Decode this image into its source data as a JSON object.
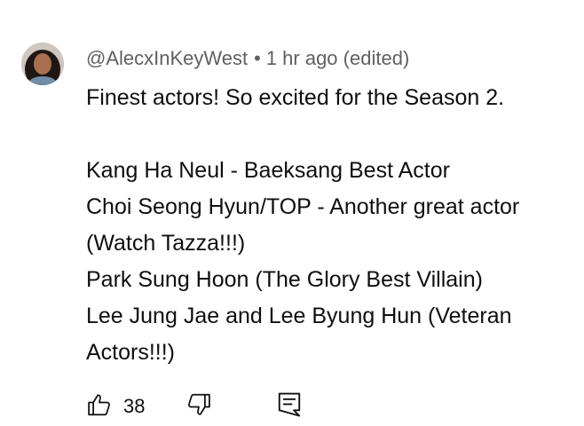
{
  "comment": {
    "author": "@AlecxInKeyWest",
    "separator": "•",
    "timestamp": "1 hr ago",
    "edited": "(edited)",
    "lines": [
      "Finest actors! So excited for the Season 2.",
      "",
      "Kang Ha Neul - Baeksang Best Actor",
      "Choi Seong Hyun/TOP - Another great actor",
      "(Watch Tazza!!!)",
      "Park Sung Hoon (The Glory Best Villain)",
      "Lee Jung Jae and Lee Byung Hun (Veteran",
      "Actors!!!)"
    ]
  },
  "actions": {
    "like_icon": "thumbs-up-icon",
    "like_count": "38",
    "dislike_icon": "thumbs-down-icon",
    "reply_icon": "comment-reply-icon"
  }
}
